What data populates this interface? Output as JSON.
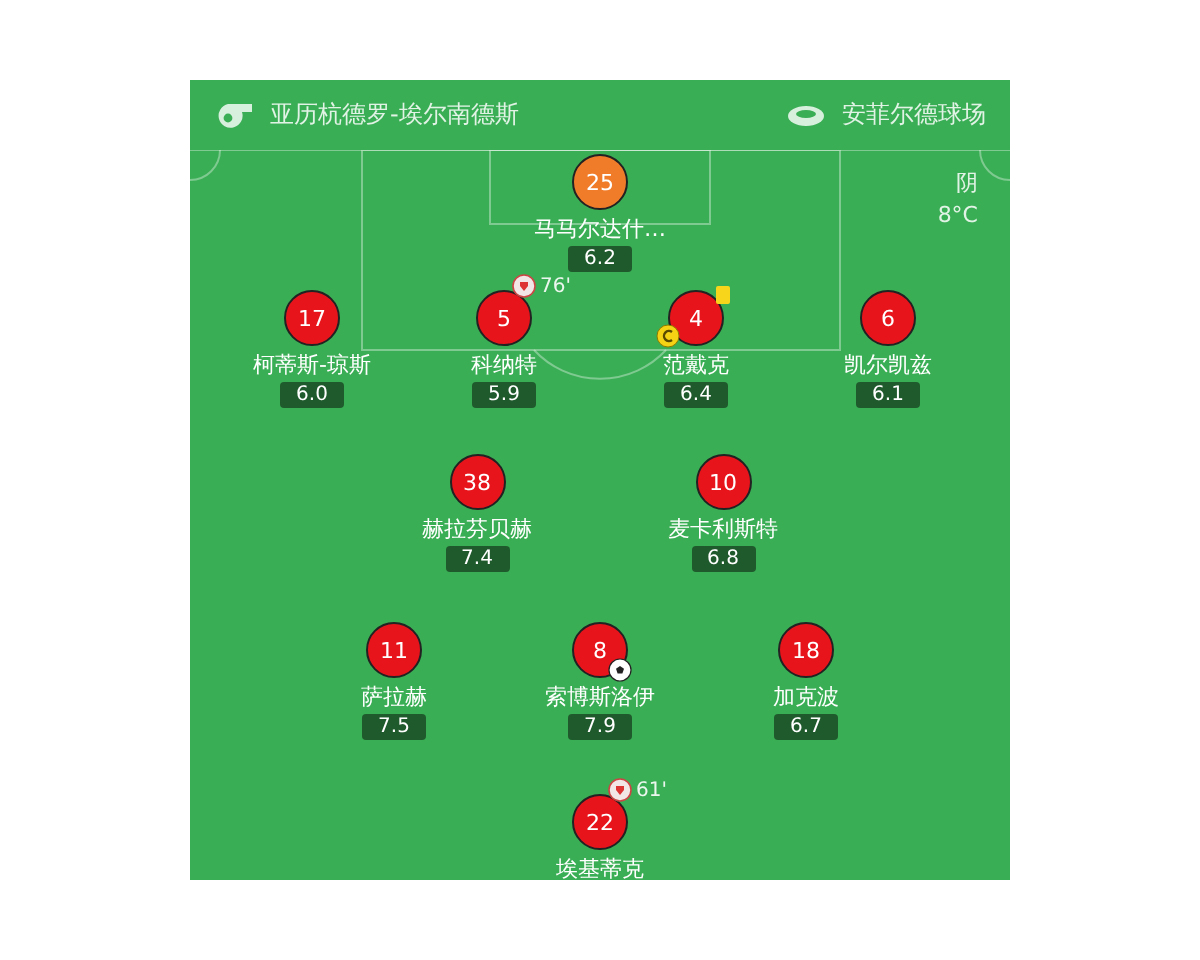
{
  "header": {
    "match": "亚历杭德罗-埃尔南德斯",
    "stadium": "安菲尔德球场"
  },
  "weather": {
    "condition": "阴",
    "temperature": "8°C"
  },
  "rows": [
    {
      "players": [
        {
          "number": "25",
          "name": "马马尔达什…",
          "rating": "6.2",
          "color": "#f07c2a",
          "captain": false,
          "yellow_card": false,
          "goal": false
        }
      ]
    },
    {
      "players": [
        {
          "number": "17",
          "name": "柯蒂斯-琼斯",
          "rating": "6.0",
          "color": "#e8141c",
          "captain": false,
          "yellow_card": false,
          "goal": false
        },
        {
          "number": "5",
          "name": "科纳特",
          "rating": "5.9",
          "color": "#e8141c",
          "captain": false,
          "yellow_card": false,
          "goal": false,
          "sub_minute": "76'"
        },
        {
          "number": "4",
          "name": "范戴克",
          "rating": "6.4",
          "color": "#e8141c",
          "captain": true,
          "yellow_card": true,
          "goal": false
        },
        {
          "number": "6",
          "name": "凯尔凯兹",
          "rating": "6.1",
          "color": "#e8141c",
          "captain": false,
          "yellow_card": false,
          "goal": false
        }
      ]
    },
    {
      "players": [
        {
          "number": "38",
          "name": "赫拉芬贝赫",
          "rating": "7.4",
          "color": "#e8141c",
          "captain": false,
          "yellow_card": false,
          "goal": false
        },
        {
          "number": "10",
          "name": "麦卡利斯特",
          "rating": "6.8",
          "color": "#e8141c",
          "captain": false,
          "yellow_card": false,
          "goal": false
        }
      ]
    },
    {
      "players": [
        {
          "number": "11",
          "name": "萨拉赫",
          "rating": "7.5",
          "color": "#e8141c",
          "captain": false,
          "yellow_card": false,
          "goal": false
        },
        {
          "number": "8",
          "name": "索博斯洛伊",
          "rating": "7.9",
          "color": "#e8141c",
          "captain": false,
          "yellow_card": false,
          "goal": true
        },
        {
          "number": "18",
          "name": "加克波",
          "rating": "6.7",
          "color": "#e8141c",
          "captain": false,
          "yellow_card": false,
          "goal": false
        }
      ]
    },
    {
      "players": [
        {
          "number": "22",
          "name": "埃基蒂克",
          "color": "#e8141c",
          "captain": false,
          "yellow_card": false,
          "goal": false,
          "sub_minute": "61'"
        }
      ]
    }
  ]
}
